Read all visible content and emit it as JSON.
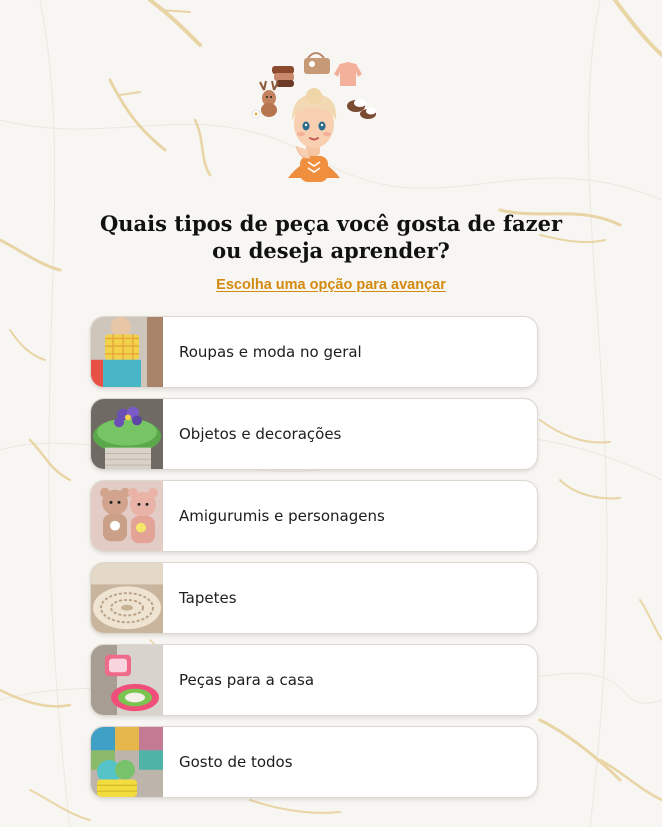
{
  "title": "Quais tipos de peça você gosta de fazer ou deseja aprender?",
  "subtitle": "Escolha uma opção para avançar",
  "illustration": {
    "subject": "girl-thinking-icon",
    "items": [
      "yarn-stack-icon",
      "tote-bag-icon",
      "sweater-icon",
      "reindeer-toy-icon",
      "baby-shoes-icon",
      "flower-icon"
    ]
  },
  "options": [
    {
      "label": "Roupas e moda no geral",
      "thumbnail": "clothing-photo"
    },
    {
      "label": "Objetos e decorações",
      "thumbnail": "flower-pot-photo"
    },
    {
      "label": "Amigurumis e personagens",
      "thumbnail": "amigurumi-dolls-photo"
    },
    {
      "label": "Tapetes",
      "thumbnail": "rug-photo"
    },
    {
      "label": "Peças para a casa",
      "thumbnail": "home-mats-photo"
    },
    {
      "label": "Gosto de todos",
      "thumbnail": "yarn-basket-photo"
    }
  ],
  "colors": {
    "accent": "#d38a10",
    "background": "#f7f5f1",
    "text": "#111111",
    "card": "#ffffff"
  }
}
